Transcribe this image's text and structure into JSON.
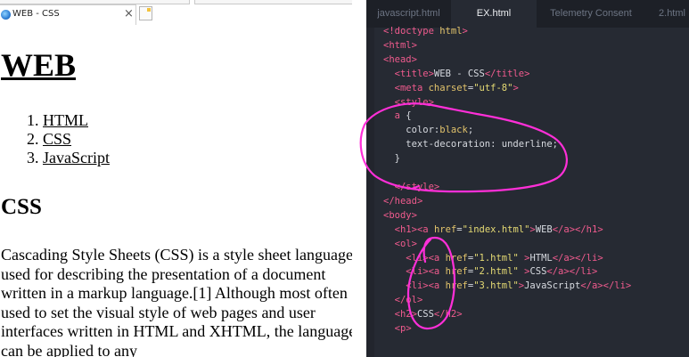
{
  "browser": {
    "tab": {
      "title": "WEB - CSS",
      "close": "×"
    },
    "page": {
      "h1": "WEB",
      "list": [
        "HTML",
        "CSS",
        "JavaScript"
      ],
      "h2": "CSS",
      "paragraph": "Cascading Style Sheets (CSS) is a style sheet language used for describing the presentation of a document written in a markup language.[1] Although most often used to set the visual style of web pages and user interfaces written in HTML and XHTML, the language can be applied to any"
    }
  },
  "editor": {
    "tabs": [
      {
        "label": "javascript.html",
        "active": false
      },
      {
        "label": "EX.html",
        "active": true
      },
      {
        "label": "Telemetry Consent",
        "active": false
      },
      {
        "label": "2.html",
        "active": false
      }
    ],
    "lines": [
      "<!doctype html>",
      "<html>",
      "<head>",
      "  <title>WEB - CSS</title>",
      "  <meta charset=\"utf-8\">",
      "  <style>",
      "  a {",
      "    color:black;",
      "    text-decoration: underline;",
      "  }",
      "",
      "  </style>",
      "</head>",
      "<body>",
      "  <h1><a href=\"index.html\">WEB</a></h1>",
      "  <ol>",
      "    <li><a href=\"1.html\" >HTML</a></li>",
      "    <li><a href=\"2.html\" >CSS</a></li>",
      "    <li><a href=\"3.html\">JavaScript</a></li>",
      "  </ol>",
      "  <h2>CSS</h2>",
      "  <p>"
    ],
    "annotation_color": "#ff2fd8"
  }
}
